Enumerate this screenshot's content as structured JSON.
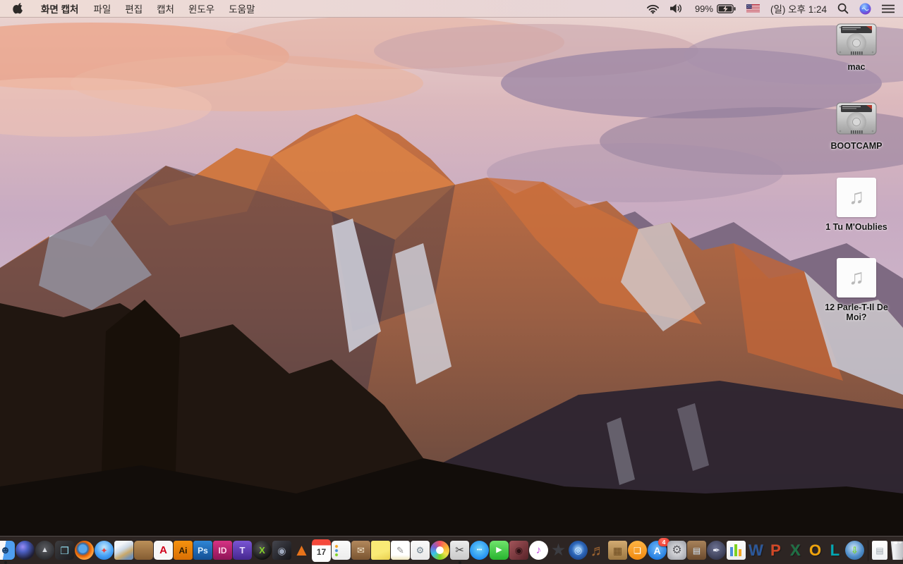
{
  "menu_bar": {
    "app_menus": [
      "화면 캡처",
      "파일",
      "편집",
      "캡처",
      "윈도우",
      "도움말"
    ],
    "status": {
      "battery_percent": "99%",
      "battery_charging": true,
      "input_source": "U.S. flag",
      "clock": "(일) 오후 1:24"
    },
    "status_icons": [
      "wifi",
      "volume",
      "battery-charging",
      "us-flag",
      "spotlight-search",
      "siri",
      "notification-center"
    ]
  },
  "desktop": {
    "icons": [
      {
        "type": "drive",
        "label": "mac"
      },
      {
        "type": "drive",
        "label": "BOOTCAMP"
      },
      {
        "type": "music",
        "label": "1 Tu M'Oublies"
      },
      {
        "type": "music",
        "label": "12 Parle-T-Il De Moi?"
      }
    ],
    "music_glyph": "♫"
  },
  "colors": {
    "menubar_bg": "#ecd8d3",
    "dock_bg": "rgba(68,58,56,0.55)",
    "badge_red": "#e0281c",
    "sunlit_rock": "#c96f3f",
    "shadow_rock": "#4a3e44",
    "snow": "#d8dce8",
    "foreground_rock": "#1d1410"
  },
  "dock": {
    "items": [
      {
        "n": "finder",
        "g": "☻",
        "fg": "#17406e",
        "bg": "linear-gradient(100deg,#f8f8f8 46%,#4f9ff0 46%)",
        "r": "22%",
        "fs": 15,
        "dot": true
      },
      {
        "n": "siri",
        "g": "",
        "bg": "radial-gradient(circle at 38% 32%,#9a8cf5 0%,#4a5ec0 30%,#202038 70%,#121220 100%)",
        "r": "50%"
      },
      {
        "n": "launchpad",
        "g": "▲",
        "fg": "#d6d9de",
        "bg": "radial-gradient(circle at 50% 40%,#5c5d62,#2a2b2f 75%)",
        "r": "50%",
        "fs": 11
      },
      {
        "n": "mission-control",
        "g": "❐",
        "fg": "#8fd8ea",
        "bg": "linear-gradient(135deg,#3d3d40,#1c1c1f)",
        "r": "20%",
        "fs": 14
      },
      {
        "n": "firefox",
        "g": "",
        "bg": "radial-gradient(circle at 42% 42%,#5aa7ea 0 25%,#2f6cab 33%,#e66000 46%,#ffa23e 68%,#cf5f0a 100%)",
        "r": "50%"
      },
      {
        "n": "safari",
        "g": "✦",
        "fg": "#e64545",
        "bg": "radial-gradient(circle at 50% 35%,#c4e9ff,#47a1f5 55%,#1a6fd0)",
        "r": "50%",
        "fs": 12
      },
      {
        "n": "preview",
        "g": "",
        "bg": "linear-gradient(150deg,#f3f6fa 25%,#cdd9e6 45%,#c9a86b 65%,#7593b5 85%)",
        "r": "12%"
      },
      {
        "n": "contacts",
        "g": "",
        "bg": "linear-gradient(#bb9059,#855d33)",
        "r": "18%"
      },
      {
        "n": "adobe-reader",
        "g": "A",
        "fg": "#d0021b",
        "bg": "#f7f7f7",
        "r": "18%",
        "fs": 15
      },
      {
        "n": "illustrator",
        "g": "Ai",
        "fg": "#2a1a00",
        "bg": "linear-gradient(#f5920f,#d96f04)",
        "r": "12%",
        "fs": 12
      },
      {
        "n": "photoshop",
        "g": "Ps",
        "fg": "#dff0ff",
        "bg": "linear-gradient(#2f86d6,#134f93)",
        "r": "12%",
        "fs": 12
      },
      {
        "n": "indesign",
        "g": "ID",
        "fg": "#ffd7ea",
        "bg": "linear-gradient(#d63384,#8e1457)",
        "r": "12%",
        "fs": 12
      },
      {
        "n": "toast",
        "g": "T",
        "fg": "#e8dcff",
        "bg": "linear-gradient(#7a55d4,#45278f)",
        "r": "18%",
        "fs": 13
      },
      {
        "n": "green-x-sphere",
        "g": "X",
        "fg": "#86d42a",
        "bg": "radial-gradient(circle at 40% 35%,#555,#101010 75%)",
        "r": "50%",
        "fs": 13
      },
      {
        "n": "dark-disk",
        "g": "◉",
        "fg": "#9fa9bd",
        "bg": "linear-gradient(135deg,#45464e,#131317)",
        "r": "15%",
        "fs": 14
      },
      {
        "n": "vlc",
        "g": "▲",
        "fg": "#e8731a",
        "bg": "transparent",
        "r": "0",
        "fs": 24
      },
      {
        "n": "calendar",
        "g": "17",
        "fg": "#3a3a3a",
        "bg": "linear-gradient(#f5493b 0 26%,#fdfdfd 26%)",
        "r": "18%",
        "fs": 12,
        "pt": 5
      },
      {
        "n": "reminders",
        "g": "",
        "bg": "radial-gradient(circle at 7px 8px,#f5a623 0 1.5px,transparent 2.5px),radial-gradient(circle at 7px 14px,#4a90d9 0 1.5px,transparent 2.5px),radial-gradient(circle at 7px 20px,#7ed321 0 1.5px,transparent 2.5px),linear-gradient(#fbfbfb,#ececec)",
        "r": "18%"
      },
      {
        "n": "mail-archive-box",
        "g": "✉",
        "fg": "#f0e2c8",
        "bg": "linear-gradient(#b2885c,#7b5531)",
        "r": "15%",
        "fs": 13
      },
      {
        "n": "stickies",
        "g": "",
        "bg": "linear-gradient(160deg,#f9ea76 60%,#e9d04e)",
        "r": "10%"
      },
      {
        "n": "textedit",
        "g": "✎",
        "fg": "#8a8a8a",
        "bg": "linear-gradient(#ffffff 75%,#efe6bd)",
        "r": "12%",
        "fs": 13
      },
      {
        "n": "document-gear",
        "g": "⚙",
        "fg": "#70828f",
        "bg": "linear-gradient(#fafafa,#e8e8e8)",
        "r": "14%",
        "fs": 13
      },
      {
        "n": "photos",
        "g": "",
        "bg": "radial-gradient(circle,#ffffff 0 27%,rgba(255,255,255,0) 29%),conic-gradient(#f5515f,#f7a934,#f3e14c,#7ed321,#38c3e8,#7a5fd0,#f5515f)",
        "r": "50%"
      },
      {
        "n": "grab-screen-capture",
        "g": "✂",
        "fg": "#3f3f3f",
        "bg": "linear-gradient(#ececec,#c9c9c9)",
        "r": "15%",
        "fs": 15,
        "dot": true
      },
      {
        "n": "messages",
        "g": "•••",
        "fg": "#ffffff",
        "bg": "radial-gradient(circle at 50% 42%,#71d3fa,#1d8cf0 75%)",
        "r": "50%",
        "fs": 7
      },
      {
        "n": "facetime",
        "g": "▶",
        "fg": "#ffffff",
        "bg": "linear-gradient(#70e36c,#27b52f)",
        "r": "22%",
        "fs": 11
      },
      {
        "n": "photo-booth",
        "g": "◉",
        "fg": "#2b1013",
        "bg": "linear-gradient(135deg,#a3555a,#572228)",
        "r": "15%",
        "fs": 13
      },
      {
        "n": "itunes",
        "g": "♪",
        "fg": "#c44ae0",
        "bg": "radial-gradient(circle,#ffffff 70%,#ededed)",
        "r": "50%",
        "fs": 15
      },
      {
        "n": "imovie",
        "g": "★",
        "fg": "#3c3d42",
        "bg": "transparent",
        "r": "0",
        "fs": 24
      },
      {
        "n": "idvd",
        "g": "◎",
        "fg": "#cfe4fb",
        "bg": "radial-gradient(circle at 50% 45%,#8fc0f0 0 15%,#2c66b8 45%,#132f6b)",
        "r": "50%",
        "fs": 13
      },
      {
        "n": "garageband",
        "g": "♬",
        "fg": "#9a6230",
        "bg": "transparent",
        "r": "0",
        "fs": 22
      },
      {
        "n": "collage-board",
        "g": "▦",
        "fg": "#6e4d22",
        "bg": "linear-gradient(#d2ab72,#9c7742)",
        "r": "12%",
        "fs": 14
      },
      {
        "n": "ibooks",
        "g": "❏",
        "fg": "#ffffff",
        "bg": "linear-gradient(#ffb443,#f18a10)",
        "r": "50%",
        "fs": 12
      },
      {
        "n": "app-store",
        "g": "A",
        "fg": "#ffffff",
        "bg": "radial-gradient(circle at 50% 40%,#73bbf8,#1f7ae0 75%)",
        "r": "50%",
        "fs": 14,
        "badge": "4"
      },
      {
        "n": "system-preferences",
        "g": "⚙",
        "fg": "#5a5b61",
        "bg": "radial-gradient(circle,#ebebed,#a9abb2 80%)",
        "r": "22%",
        "fs": 16
      },
      {
        "n": "keynote",
        "g": "▤",
        "fg": "#cfe2f5",
        "bg": "linear-gradient(#a8825a,#6b4b2e)",
        "r": "15%",
        "fs": 12
      },
      {
        "n": "pages",
        "g": "✒",
        "fg": "#eceef8",
        "bg": "radial-gradient(circle at 45% 38%,#6d7292,#31344a 80%)",
        "r": "50%",
        "fs": 13
      },
      {
        "n": "numbers",
        "g": "",
        "bg": "linear-gradient(#4a90d9,#4a90d9) 5px 9px/4px 13px no-repeat,linear-gradient(#7ed321,#7ed321) 11px 5px/4px 17px no-repeat,linear-gradient(#f5a623,#f5a623) 17px 12px/4px 10px no-repeat,linear-gradient(#fcfcfc,#ededed)",
        "r": "12%"
      },
      {
        "n": "word",
        "g": "W",
        "fg": "#2b579a",
        "bg": "transparent",
        "r": "0",
        "fs": 22,
        "cls": "letter"
      },
      {
        "n": "powerpoint",
        "g": "P",
        "fg": "#d24726",
        "bg": "transparent",
        "r": "0",
        "fs": 22,
        "cls": "letter"
      },
      {
        "n": "excel",
        "g": "X",
        "fg": "#1e7145",
        "bg": "transparent",
        "r": "0",
        "fs": 22,
        "cls": "letter"
      },
      {
        "n": "outlook",
        "g": "O",
        "fg": "#f0a30a",
        "bg": "transparent",
        "r": "0",
        "fs": 22,
        "cls": "letter"
      },
      {
        "n": "lync",
        "g": "L",
        "fg": "#00a8b4",
        "bg": "transparent",
        "r": "0",
        "fs": 22,
        "cls": "letter"
      },
      {
        "n": "globe-downloader",
        "g": "⇩",
        "fg": "#74d22e",
        "bg": "radial-gradient(circle at 45% 38%,#cfe6f8,#4e8cc8 55%,#27598f)",
        "r": "50%",
        "fs": 13
      },
      {
        "type": "separator"
      },
      {
        "n": "document-file",
        "g": "▤",
        "fg": "#9aa4ac",
        "bg": "linear-gradient(#ffffff,#eef1f4)",
        "r": "10%",
        "fs": 12,
        "w": 22
      },
      {
        "n": "trash",
        "g": "",
        "bg": "radial-gradient(circle at 40% 8%,#ffffff 0 2px,transparent 3px),radial-gradient(circle at 62% 6%,#e8e8e8 0 2px,transparent 3px),linear-gradient(90deg,#cfd0d4,#f2f3f5 30%,#b5b6bb 85%)",
        "clip": "polygon(14% 3%, 86% 3%, 76% 100%, 24% 100%)",
        "r": "8%"
      }
    ]
  }
}
